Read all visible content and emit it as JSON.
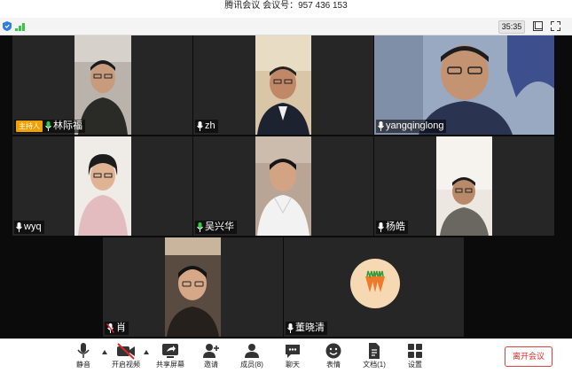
{
  "window": {
    "title": "腾讯会议 会议号：957 436 153",
    "timer": "35:35"
  },
  "topbar_icons": [
    "shield-icon",
    "signal-icon",
    "fit-window-icon",
    "fullscreen-icon"
  ],
  "participants": [
    {
      "name": "林际福",
      "host_badge": "主持人",
      "mic": "mic-active-icon",
      "has_video": true
    },
    {
      "name": "zh",
      "mic": "mic-icon",
      "has_video": true
    },
    {
      "name": "yangqinglong",
      "mic": "mic-icon",
      "has_video": true
    },
    {
      "name": "wyq",
      "mic": "mic-icon",
      "has_video": true
    },
    {
      "name": "吴兴华",
      "mic": "mic-active-icon",
      "has_video": true
    },
    {
      "name": "杨皓",
      "mic": "mic-icon",
      "has_video": true
    },
    {
      "name": "肖",
      "mic": "mic-muted-icon",
      "has_video": true
    },
    {
      "name": "董晓清",
      "mic": "mic-icon",
      "has_video": false,
      "avatar": "carrots-avatar-icon"
    }
  ],
  "toolbar": {
    "mute": "静音",
    "start_video": "开启视频",
    "share_screen": "共享屏幕",
    "invite": "邀请",
    "members": "成员(8)",
    "chat": "聊天",
    "reactions": "表情",
    "docs": "文档(1)",
    "settings": "设置",
    "leave": "离开会议"
  },
  "colors": {
    "accent_green": "#2ecc40",
    "host_badge": "#f0a000",
    "leave_red": "#e02828",
    "tile_bg": "#262626"
  }
}
